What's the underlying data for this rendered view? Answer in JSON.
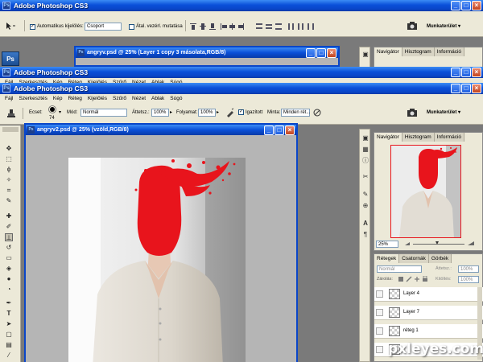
{
  "app": {
    "title": "Adobe Photoshop CS3",
    "ps_logo": "Ps"
  },
  "menu": [
    "Fájl",
    "Szerkesztés",
    "Kép",
    "Réteg",
    "Kijelölés",
    "Szűrő",
    "Nézet",
    "Ablak",
    "Súgó"
  ],
  "move_options": {
    "auto_select_label": "Automatikus kijelölés:",
    "auto_select_value": "Csoport",
    "transform_label": "Átal. vezérl. mutatása",
    "workspace_label": "Munkaterület ▾"
  },
  "brush_options": {
    "brush_label": "Ecset:",
    "brush_size": "74",
    "mode_label": "Mód:",
    "mode_value": "Normál",
    "opacity_label": "Áttetsz.:",
    "opacity_value": "100%",
    "flow_label": "Folyamat:",
    "flow_value": "100%",
    "aligned_label": "Igazított",
    "sample_label": "Minta:",
    "sample_value": "Minden rét...",
    "workspace_label": "Munkaterület ▾"
  },
  "doc_back": {
    "title": "angryv.psd @ 25% (Layer 1 copy 3 másolata,RGB/8)"
  },
  "doc_front": {
    "title": "angryv2.psd @ 25% (vzöld,RGB/8)"
  },
  "navigator": {
    "tabs": [
      "Navigátor",
      "Hisztogram",
      "Információ"
    ],
    "zoom": "25%"
  },
  "layers": {
    "tabs": [
      "Rétegek",
      "Csatornák",
      "Görbék"
    ],
    "blend_mode": "Normál",
    "opacity_label": "Áttetsz.:",
    "opacity_value": "100%",
    "lock_label": "Zárolás:",
    "fill_label": "Kitöltés:",
    "fill_value": "100%",
    "items": [
      {
        "name": "Layer 4"
      },
      {
        "name": "Layer 7"
      },
      {
        "name": "réteg 1"
      },
      {
        "name": ""
      }
    ]
  },
  "watermark": "pxleyes.com",
  "colors": {
    "xp_title_blue": "#0a4fd8",
    "chrome": "#ece9d8",
    "workspace_gray": "#7a7a7a",
    "paint_red": "#e8141c"
  },
  "icons": {
    "move_tool": "move-tool-icon",
    "clone_stamp": "clone-stamp-icon",
    "eye": "visibility-eye-icon"
  }
}
